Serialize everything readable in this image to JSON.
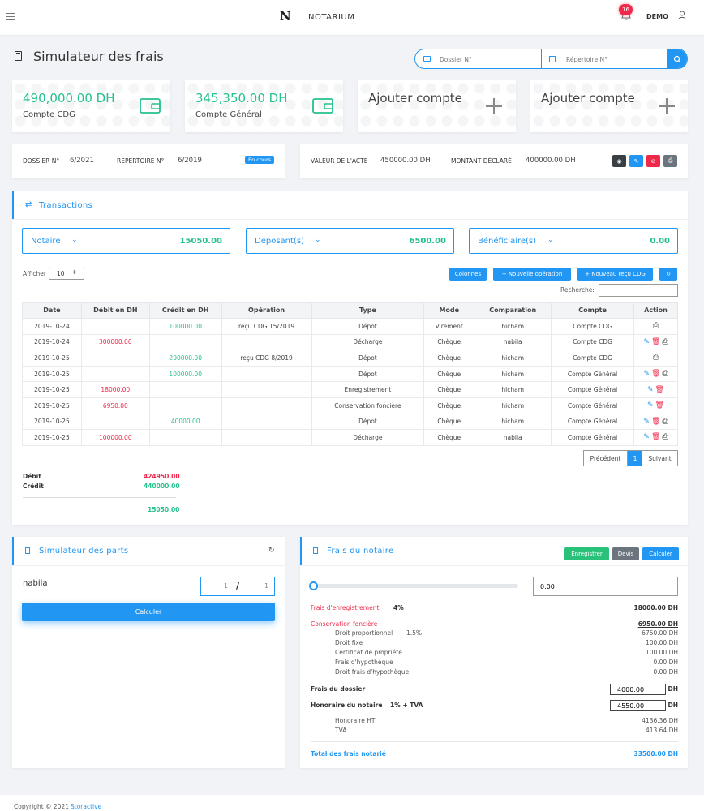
{
  "header": {
    "brand": "NOTARIUM",
    "notif_count": "16",
    "user": "DEMO"
  },
  "page": {
    "title": "Simulateur des frais"
  },
  "search": {
    "dossier_placeholder": "Dossier N°",
    "repertoire_placeholder": "Répertoire N°"
  },
  "accounts": [
    {
      "amount": "490,000.00 DH",
      "label": "Compte CDG"
    },
    {
      "amount": "345,350.00 DH",
      "label": "Compte Général"
    },
    {
      "label": "Ajouter compte"
    },
    {
      "label": "Ajouter compte"
    }
  ],
  "dossier": {
    "dossier_label": "DOSSIER N°",
    "dossier_value": "6/2021",
    "repertoire_label": "REPERTOIRE N°",
    "repertoire_value": "6/2019",
    "status": "En cours"
  },
  "acte": {
    "valeur_label": "VALEUR DE L'ACTE",
    "valeur_value": "450000.00 DH",
    "montant_label": "MONTANT DÉCLARÉ",
    "montant_value": "400000.00 DH"
  },
  "transactions": {
    "title": "Transactions",
    "summary": [
      {
        "label": "Notaire",
        "value": "15050.00"
      },
      {
        "label": "Déposant(s)",
        "value": "6500.00"
      },
      {
        "label": "Bénéficiaire(s)",
        "value": "0.00"
      }
    ],
    "afficher_label": "Afficher",
    "afficher_value": "10",
    "buttons": {
      "colonnes": "Colonnes",
      "nouvelle": "+ Nouvelle opération",
      "recu": "+ Nouveau reçu CDG"
    },
    "recherche_label": "Recherche:",
    "columns": [
      "Date",
      "Débit en DH",
      "Crédit en DH",
      "Opération",
      "Type",
      "Mode",
      "Comparation",
      "Compte",
      "Action"
    ],
    "rows": [
      {
        "date": "2019-10-24",
        "debit": "",
        "credit": "100000.00",
        "operation": "reçu CDG 15/2019",
        "type": "Dépot",
        "mode": "Virement",
        "comparation": "hicham",
        "compte": "Compte CDG",
        "actions": "p"
      },
      {
        "date": "2019-10-24",
        "debit": "300000.00",
        "credit": "",
        "operation": "",
        "type": "Décharge",
        "mode": "Chèque",
        "comparation": "nabila",
        "compte": "Compte CDG",
        "actions": "edp"
      },
      {
        "date": "2019-10-25",
        "debit": "",
        "credit": "200000.00",
        "operation": "reçu CDG 8/2019",
        "type": "Dépot",
        "mode": "Chèque",
        "comparation": "hicham",
        "compte": "Compte CDG",
        "actions": "p"
      },
      {
        "date": "2019-10-25",
        "debit": "",
        "credit": "100000.00",
        "operation": "",
        "type": "Dépot",
        "mode": "Chèque",
        "comparation": "hicham",
        "compte": "Compte Général",
        "actions": "edp"
      },
      {
        "date": "2019-10-25",
        "debit": "18000.00",
        "credit": "",
        "operation": "",
        "type": "Enregistrement",
        "mode": "Chèque",
        "comparation": "hicham",
        "compte": "Compte Général",
        "actions": "ed"
      },
      {
        "date": "2019-10-25",
        "debit": "6950.00",
        "credit": "",
        "operation": "",
        "type": "Conservation foncière",
        "mode": "Chèque",
        "comparation": "hicham",
        "compte": "Compte Général",
        "actions": "ed"
      },
      {
        "date": "2019-10-25",
        "debit": "",
        "credit": "40000.00",
        "operation": "",
        "type": "Dépot",
        "mode": "Chèque",
        "comparation": "hicham",
        "compte": "Compte Général",
        "actions": "edp"
      },
      {
        "date": "2019-10-25",
        "debit": "100000.00",
        "credit": "",
        "operation": "",
        "type": "Décharge",
        "mode": "Chèque",
        "comparation": "nabila",
        "compte": "Compte Général",
        "actions": "edp"
      }
    ],
    "pagination": {
      "prev": "Précédent",
      "page": "1",
      "next": "Suivant"
    },
    "totals": {
      "debit_label": "Débit",
      "debit_value": "424950.00",
      "credit_label": "Crédit",
      "credit_value": "440000.00",
      "balance": "15050.00"
    }
  },
  "parts": {
    "title": "Simulateur des parts",
    "name": "nabila",
    "frac_num": "1",
    "frac_den": "1",
    "button": "Calculer"
  },
  "frais": {
    "title": "Frais du notaire",
    "buttons": {
      "enregistrer": "Enregistrer",
      "devis": "Devis",
      "calculer": "Calculer"
    },
    "slider_value": 0,
    "input_value": "0.00",
    "enregistrement_label": "Frais d'enregistrement",
    "enregistrement_rate": "4%",
    "enregistrement_value": "18000.00 DH",
    "conservation_label": "Conservation foncière",
    "conservation_value": "6950.00 DH",
    "conservation_items": [
      {
        "label": "Droit proportionnel",
        "rate": "1.5%",
        "value": "6750.00 DH"
      },
      {
        "label": "Droit fixe",
        "rate": "",
        "value": "100.00 DH"
      },
      {
        "label": "Certificat de propriété",
        "rate": "",
        "value": "100.00 DH"
      },
      {
        "label": "Frais d'hypothèque",
        "rate": "",
        "value": "0.00 DH"
      },
      {
        "label": "Droit frais d'hypothèque",
        "rate": "",
        "value": "0.00 DH"
      }
    ],
    "dossier_label": "Frais du dossier",
    "dossier_value": "4000.00",
    "dh": "DH",
    "honoraire_label": "Honoraire du notaire",
    "honoraire_rate": "1% + TVA",
    "honoraire_value": "4550.00",
    "honoraire_items": [
      {
        "label": "Honoraire HT",
        "value": "4136.36 DH"
      },
      {
        "label": "TVA",
        "value": "413.64 DH"
      }
    ],
    "total_label": "Total des frais notarié",
    "total_value": "33500.00 DH"
  },
  "footer": {
    "text": "Copyright © 2021",
    "link": "Storactive"
  }
}
